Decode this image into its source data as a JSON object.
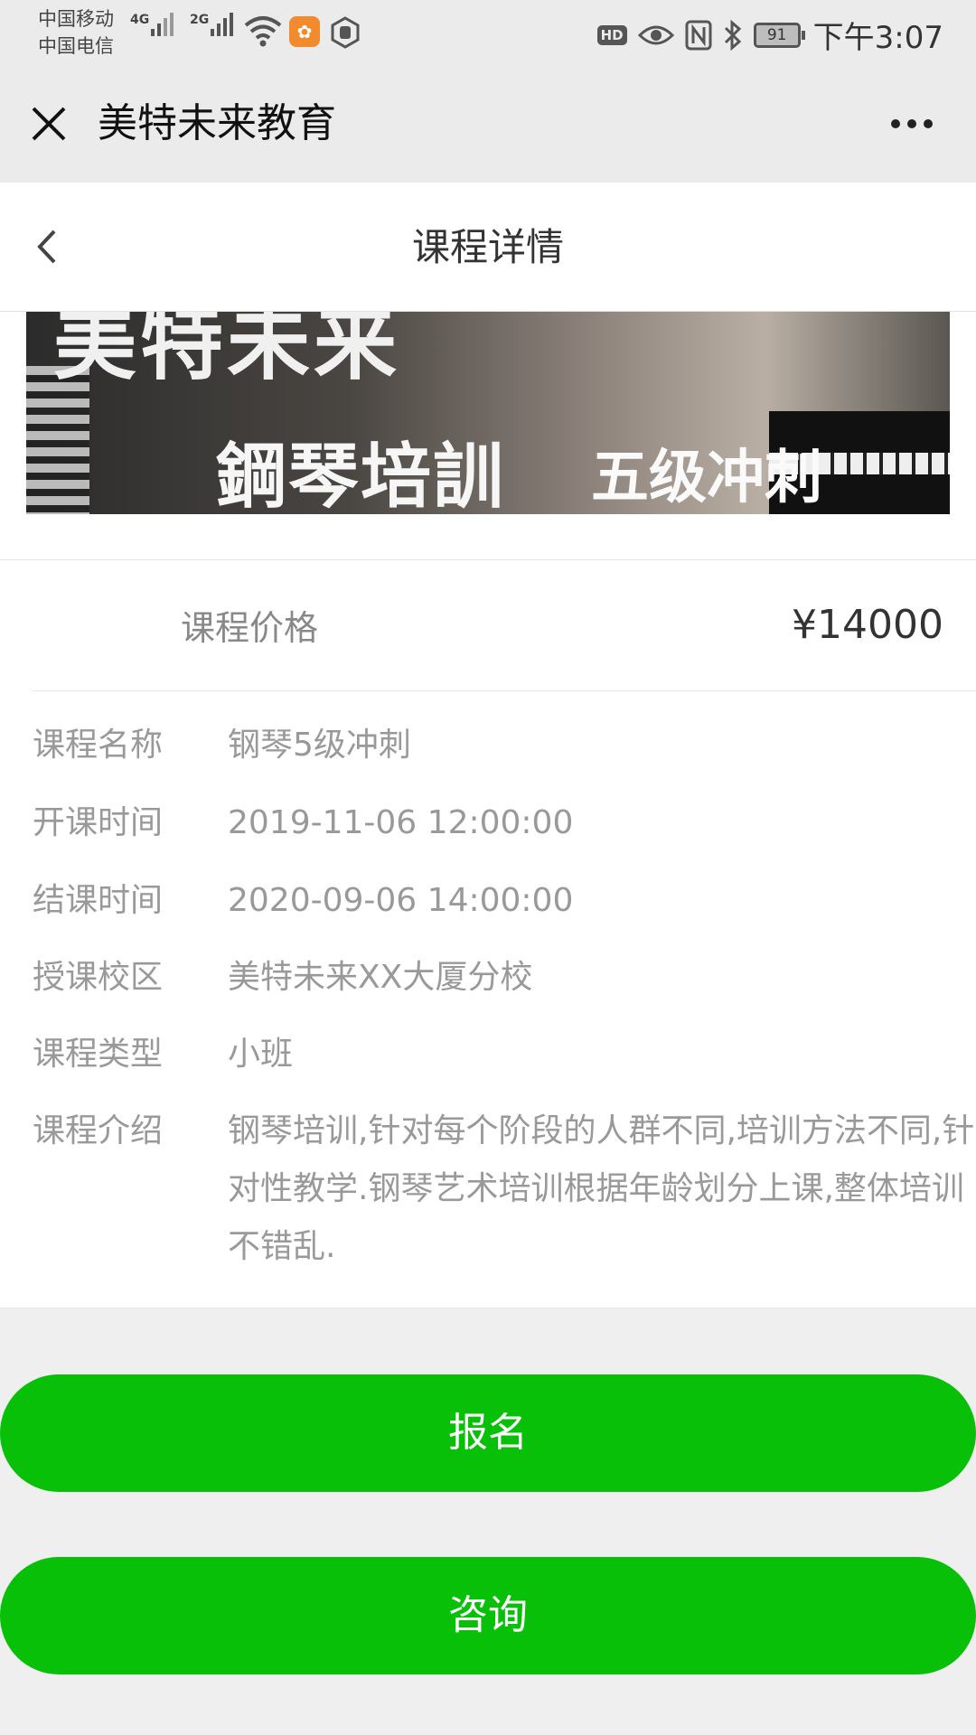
{
  "status_bar": {
    "carrier_1": "中国移动",
    "carrier_2": "中国电信",
    "net_1": "4G",
    "net_2": "2G",
    "hd": "HD",
    "battery": "91",
    "time": "下午3:07"
  },
  "titlebar": {
    "title": "美特未来教育"
  },
  "header": {
    "title": "课程详情"
  },
  "banner": {
    "top_text": "美特未来",
    "main_text": "鋼琴培訓",
    "sub_text": "五级冲刺"
  },
  "price": {
    "label": "课程价格",
    "value": "¥14000"
  },
  "info": [
    {
      "label": "课程名称",
      "value": "钢琴5级冲刺"
    },
    {
      "label": "开课时间",
      "value": "2019-11-06 12:00:00"
    },
    {
      "label": "结课时间",
      "value": "2020-09-06 14:00:00"
    },
    {
      "label": "授课校区",
      "value": "美特未来XX大厦分校"
    },
    {
      "label": "课程类型",
      "value": "小班"
    },
    {
      "label": "课程介绍",
      "value": "钢琴培训,针对每个阶段的人群不同,培训方法不同,针对性教学.钢琴艺术培训根据年龄划分上课,整体培训不错乱."
    }
  ],
  "buttons": {
    "signup": "报名",
    "consult": "咨询"
  },
  "colors": {
    "primary_green": "#07c007",
    "background": "#efefef"
  }
}
